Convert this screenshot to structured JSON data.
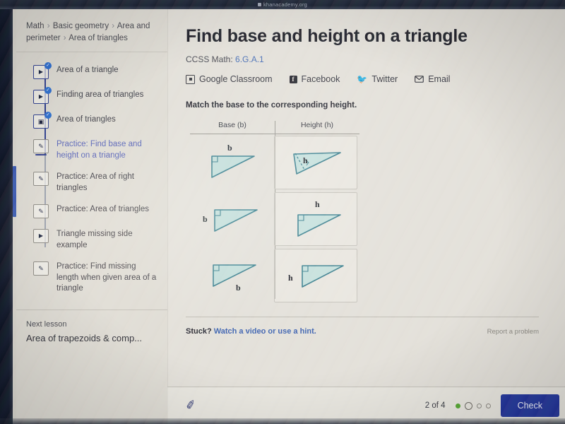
{
  "browser": {
    "url": "khanacademy.org",
    "lock_icon": "lock-icon"
  },
  "sidebar": {
    "breadcrumb": {
      "items": [
        "Math",
        "Basic geometry",
        "Area and perimeter",
        "Area of triangles"
      ],
      "separator": "›"
    },
    "lessons": [
      {
        "label": "Area of a triangle",
        "icon": "video-play-icon",
        "state": "completed",
        "badge": "check-icon"
      },
      {
        "label": "Finding area of triangles",
        "icon": "video-play-icon",
        "state": "completed",
        "badge": "check-icon"
      },
      {
        "label": "Area of triangles",
        "icon": "article-icon",
        "state": "completed",
        "badge": "check-icon"
      },
      {
        "label": "Practice: Find base and height on a triangle",
        "icon": "pencil-icon",
        "state": "active",
        "badge": ""
      },
      {
        "label": "Practice: Area of right triangles",
        "icon": "pencil-icon",
        "state": "default",
        "badge": ""
      },
      {
        "label": "Practice: Area of triangles",
        "icon": "pencil-icon",
        "state": "default",
        "badge": ""
      },
      {
        "label": "Triangle missing side example",
        "icon": "video-play-icon",
        "state": "default",
        "badge": ""
      },
      {
        "label": "Practice: Find missing length when given area of a triangle",
        "icon": "pencil-icon",
        "state": "default",
        "badge": ""
      }
    ],
    "next_lesson": {
      "kicker": "Next lesson",
      "title": "Area of trapezoids & comp..."
    }
  },
  "main": {
    "title": "Find base and height on a triangle",
    "ccss_label": "CCSS Math:",
    "ccss_code": "6.G.A.1",
    "share": [
      {
        "label": "Google Classroom",
        "icon": "google-classroom-icon"
      },
      {
        "label": "Facebook",
        "icon": "facebook-icon"
      },
      {
        "label": "Twitter",
        "icon": "twitter-icon"
      },
      {
        "label": "Email",
        "icon": "email-icon"
      }
    ],
    "exercise": {
      "prompt": "Match the base to the corresponding height.",
      "columns": [
        "Base (b)",
        "Height (h)"
      ],
      "rows": [
        {
          "base_label": "b",
          "base_label_pos": "top",
          "height_label": "h",
          "height_label_pos": "inside-dashed"
        },
        {
          "base_label": "b",
          "base_label_pos": "left",
          "height_label": "h",
          "height_label_pos": "top"
        },
        {
          "base_label": "b",
          "base_label_pos": "bottom-right",
          "height_label": "h",
          "height_label_pos": "left"
        }
      ]
    },
    "footer": {
      "stuck_prefix": "Stuck?",
      "stuck_link": "Watch a video or use a hint.",
      "report": "Report a problem"
    },
    "bottom": {
      "scratchpad_icon": "scratchpad-pencil-icon",
      "question_count": "2 of 4",
      "progress_dots": [
        "done",
        "current",
        "todo",
        "todo"
      ],
      "check_label": "Check"
    }
  },
  "colors": {
    "accent_blue": "#3b5bb5",
    "check_button": "#22349b",
    "active_text": "#5a66b8",
    "triangle_stroke": "#3d7f8e",
    "triangle_fill": "#a9dbd8",
    "progress_done": "#55a630",
    "link_blue": "#3f63b0"
  }
}
